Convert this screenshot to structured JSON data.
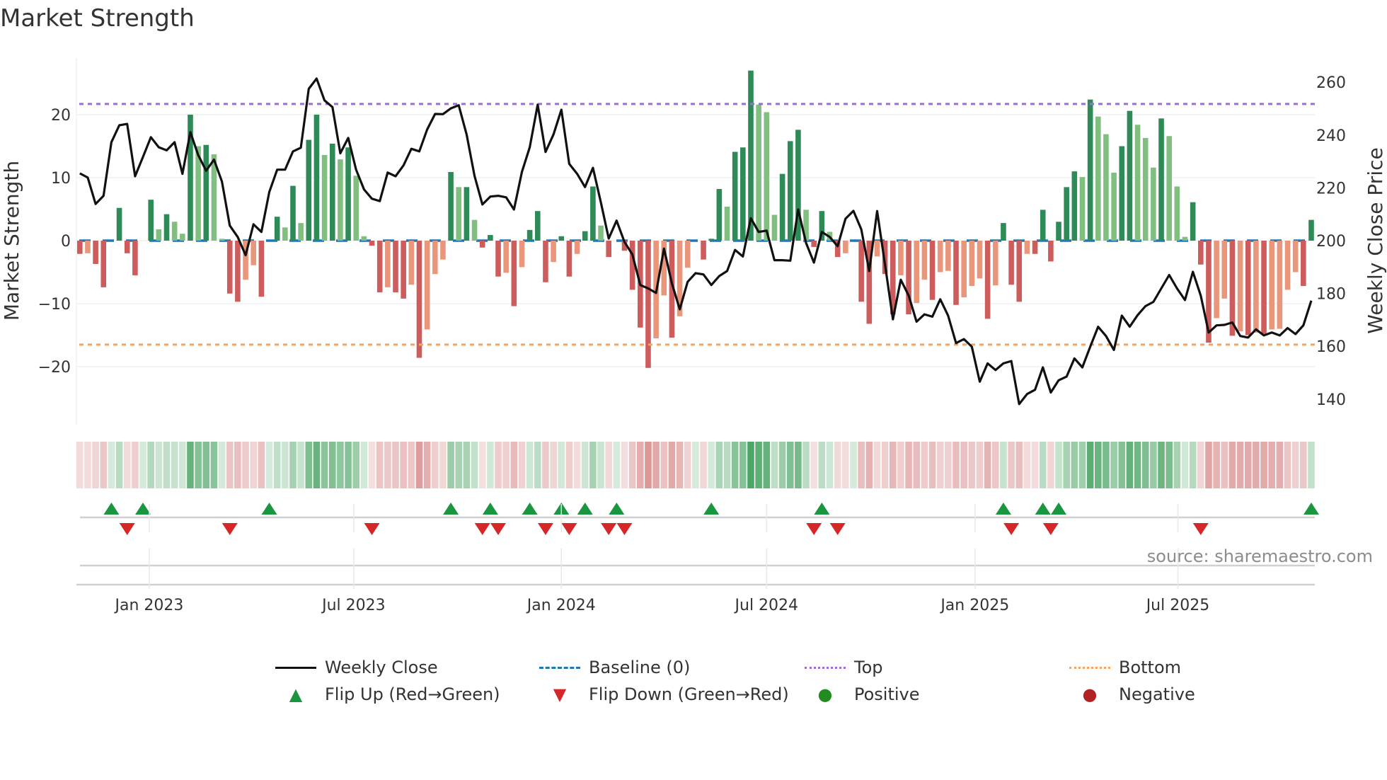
{
  "title": "Market Strength",
  "source": "source: sharemaestro.com",
  "colors": {
    "pos_strong": "#2e8b57",
    "pos_weak": "#80bf80",
    "neg_strong": "#cd5c5c",
    "neg_weak": "#e9967a",
    "baseline": "#1f77b4",
    "top": "#9b6ddb",
    "bottom": "#f4a460",
    "price": "#111111",
    "flip_up": "#1a9641",
    "flip_down": "#d62728",
    "positive": "#228b22",
    "negative": "#b22222"
  },
  "legend": [
    {
      "label": "Weekly Close",
      "icon": "solid-line"
    },
    {
      "label": "Baseline (0)",
      "icon": "dashed-line"
    },
    {
      "label": "Top",
      "icon": "dotted-line"
    },
    {
      "label": "Bottom",
      "icon": "dotted-line"
    },
    {
      "label": "Flip Up (Red→Green)",
      "icon": "triangle-up"
    },
    {
      "label": "Flip Down (Green→Red)",
      "icon": "triangle-down"
    },
    {
      "label": "Positive",
      "icon": "circle"
    },
    {
      "label": "Negative",
      "icon": "circle"
    }
  ],
  "chart_data": {
    "type": "bar+line",
    "title": "Market Strength",
    "ylabel": "Market Strength",
    "y2label": "Weekly Close Price",
    "ylim": [
      -29,
      29
    ],
    "yticks": [
      -20,
      -10,
      0,
      10,
      20
    ],
    "y2ticks": [
      140,
      160,
      180,
      200,
      220,
      240,
      260
    ],
    "top_level": 21.7,
    "bottom_level": -16.5,
    "x_ticks": [
      {
        "label": "Jan 2023",
        "week": 9.8
      },
      {
        "label": "Jul 2023",
        "week": 35.7
      },
      {
        "label": "Jan 2024",
        "week": 62.0
      },
      {
        "label": "Jul 2024",
        "week": 88.0
      },
      {
        "label": "Jan 2025",
        "week": 114.4
      },
      {
        "label": "Jul 2025",
        "week": 140.1
      }
    ],
    "strength": [
      -2.1,
      -2.0,
      -3.7,
      -7.4,
      0,
      5.2,
      -2.0,
      -5.5,
      0,
      6.5,
      1.8,
      4.2,
      3.0,
      1.1,
      20,
      15,
      15.2,
      13.7,
      0.3,
      -8.4,
      -9.7,
      -6.2,
      -3.9,
      -8.9,
      0,
      3.8,
      2.1,
      8.7,
      2.8,
      16,
      20,
      13.6,
      15.4,
      12.9,
      14.8,
      10.3,
      0.7,
      -0.8,
      -8.2,
      -7.4,
      -8.2,
      -9.2,
      -7.0,
      -18.6,
      -14.1,
      -5.3,
      -3.0,
      10.9,
      8.5,
      8.5,
      3.3,
      -1.1,
      0.9,
      -5.7,
      -5.1,
      -10.4,
      -4.2,
      1.7,
      4.7,
      -6.6,
      -3.4,
      0.7,
      -5.7,
      -2.1,
      1.5,
      8.6,
      2.4,
      -2.6,
      0,
      -1.6,
      -7.8,
      -13.8,
      -20.2,
      -15.5,
      -8.7,
      -15.4,
      -12.0,
      -4.3,
      0,
      -3.0,
      0.3,
      8.2,
      5.4,
      14.1,
      14.8,
      27,
      21.6,
      20.4,
      4.1,
      10.6,
      15.8,
      17.6,
      4.9,
      -1,
      4.7,
      1.4,
      -2.6,
      -2,
      0,
      -9.7,
      -13.2,
      -2.5,
      -5.3,
      -11.7,
      -5.5,
      -11.7,
      -9.9,
      -6.2,
      -9.4,
      -5,
      -4.8,
      -10.2,
      -9,
      -7.2,
      -6.0,
      -12.4,
      -7.1,
      2.8,
      -7,
      -9.7,
      -2.1,
      -2.1,
      4.9,
      -3.3,
      3.0,
      8.5,
      11.0,
      10.1,
      22.4,
      19.7,
      16.9,
      10.8,
      15.0,
      20.6,
      18.4,
      16.3,
      11.6,
      19.4,
      16.6,
      8.6,
      0.6,
      6.1,
      -3.8,
      -16.2,
      -12.3,
      -9.2,
      -15.1,
      -14.4,
      -15,
      -14.6,
      -14.8,
      -14.1,
      -14.0,
      -7.8,
      -5,
      -7.2,
      3.3
    ],
    "weekly_close": [
      225.5,
      223.9,
      213.9,
      217,
      237.3,
      243.7,
      244.2,
      224.4,
      231.7,
      239.2,
      235.4,
      234.2,
      237.3,
      225.3,
      241.1,
      232.4,
      226.5,
      230.7,
      222.4,
      205.7,
      201.4,
      194.5,
      206.2,
      203.3,
      218.4,
      226.9,
      226.9,
      233.8,
      235.2,
      257.5,
      261.4,
      253.1,
      250.6,
      233.1,
      238.9,
      226.9,
      219.4,
      215.9,
      215,
      225.8,
      224.4,
      228.5,
      234.8,
      233.8,
      242.1,
      248,
      247.9,
      250.1,
      251.3,
      240.2,
      224.6,
      213.7,
      216.7,
      217,
      216.4,
      211.8,
      226,
      235.4,
      251.5,
      233.6,
      240.2,
      249.6,
      229.1,
      225.3,
      220.3,
      227.6,
      214.6,
      200.8,
      207.6,
      199.5,
      194.8,
      183.2,
      181.9,
      180.2,
      197,
      183.9,
      174,
      184.4,
      187.7,
      187.2,
      183.2,
      186.6,
      188.5,
      196.5,
      194,
      208.5,
      203.3,
      203.8,
      192.6,
      192.6,
      192.4,
      211.8,
      199.1,
      191.7,
      203.3,
      201.4,
      197.9,
      208.3,
      211.3,
      204.3,
      188.5,
      211.2,
      191,
      170.2,
      185.2,
      179.2,
      169.3,
      172.1,
      171.2,
      177.8,
      171.6,
      161.2,
      162.7,
      159.8,
      146.6,
      153.5,
      151,
      153.5,
      154.4,
      138.1,
      141.9,
      143.5,
      152,
      142.5,
      147.1,
      148.5,
      155.4,
      152,
      159.8,
      167.4,
      163.9,
      158.6,
      171.6,
      167.4,
      171.8,
      175.2,
      176.8,
      181.9,
      187,
      181.9,
      177.5,
      188.2,
      179.2,
      165.2,
      167.9,
      168.1,
      169,
      163.9,
      163.3,
      166.4,
      164.1,
      165.2,
      164.1,
      166.9,
      164.6,
      167.9,
      177.3
    ],
    "flip_up_weeks": [
      5,
      9,
      25,
      48,
      53,
      58,
      62,
      65,
      69,
      81,
      95,
      118,
      123,
      125,
      157
    ],
    "flip_down_weeks": [
      7,
      20,
      38,
      52,
      54,
      60,
      63,
      68,
      70,
      94,
      97,
      119,
      124,
      143
    ]
  }
}
